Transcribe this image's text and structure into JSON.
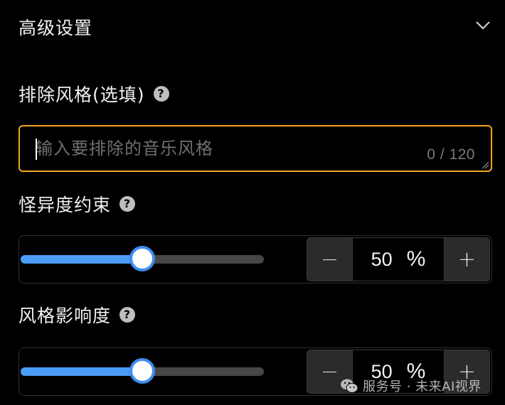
{
  "section": {
    "title": "高级设置",
    "icon": "chevron-down-icon"
  },
  "exclude_style": {
    "label": "排除风格(选填)",
    "help_icon": "?",
    "placeholder": "输入要排除的音乐风格",
    "value": "",
    "char_count": "0 / 120"
  },
  "weirdness": {
    "label": "怪异度约束",
    "help_icon": "?",
    "value": 50,
    "value_text": "50",
    "unit": "%",
    "minus": "−",
    "plus": "+"
  },
  "style_influence": {
    "label": "风格影响度",
    "help_icon": "?",
    "value": 50,
    "value_text": "50",
    "unit": "%",
    "minus": "−",
    "plus": "+"
  },
  "watermark": {
    "text": "服务号 · 未来AI视界"
  },
  "colors": {
    "accent": "#4a9cf6",
    "focus_border": "#f5a623",
    "background": "#000000"
  }
}
